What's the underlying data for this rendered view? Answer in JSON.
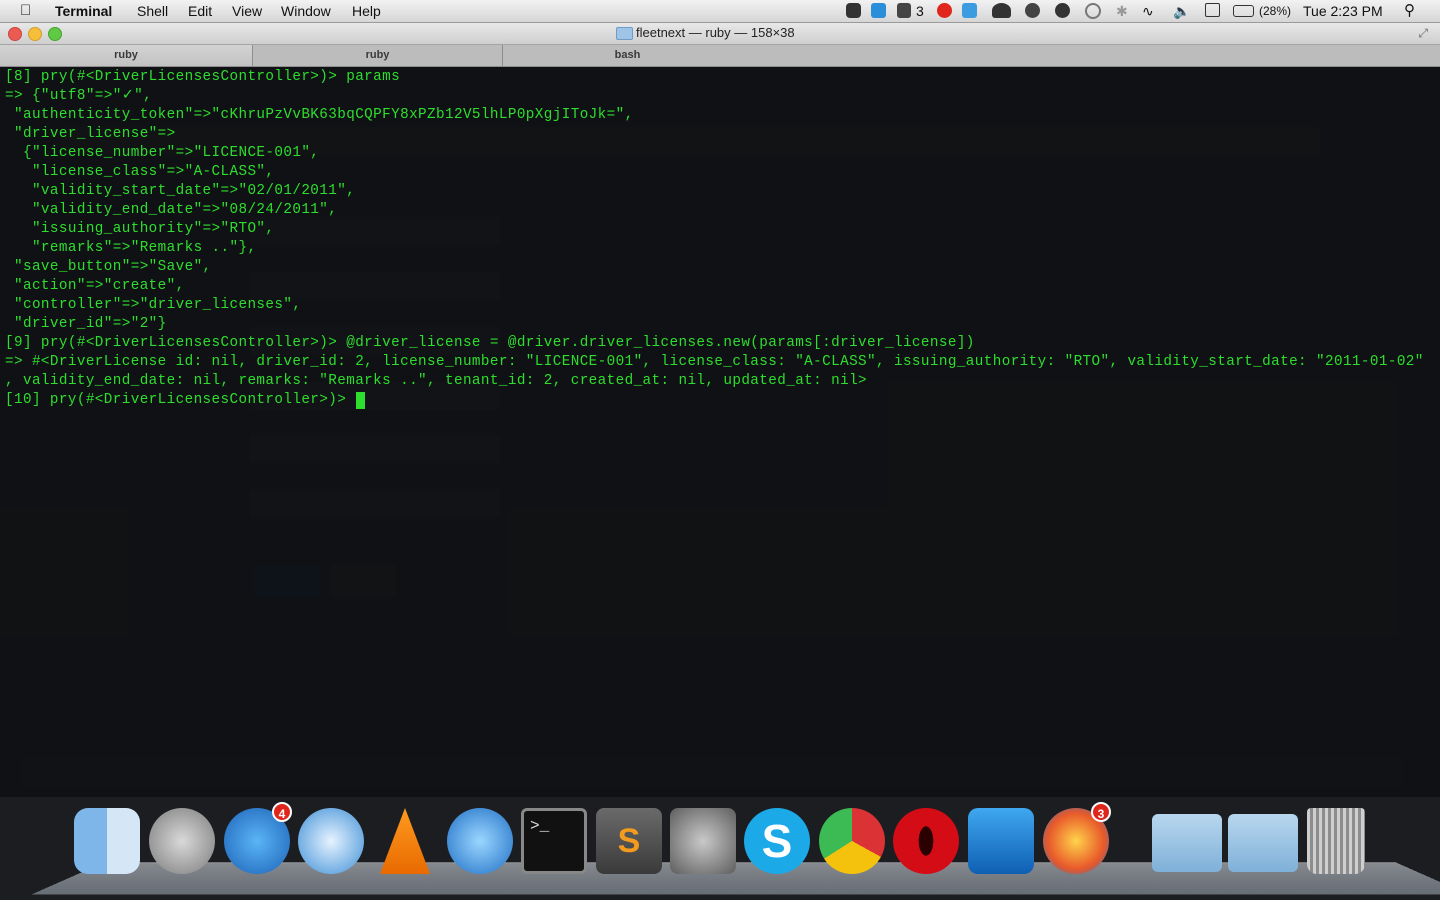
{
  "menubar": {
    "app_name": "Terminal",
    "items": [
      "Shell",
      "Edit",
      "View",
      "Window",
      "Help"
    ],
    "adobe_count": "3",
    "battery": "(28%)",
    "clock": "Tue 2:23 PM"
  },
  "window": {
    "title": "fleetnext — ruby — 158×38",
    "tabs": [
      {
        "label": "ruby",
        "active": true
      },
      {
        "label": "ruby",
        "active": false
      },
      {
        "label": "bash",
        "active": false
      }
    ]
  },
  "terminal": {
    "lines": [
      "[8] pry(#<DriverLicensesController>)> params",
      "=> {\"utf8\"=>\"✓\",",
      " \"authenticity_token\"=>\"cKhruPzVvBK63bqCQPFY8xPZb12V5lhLP0pXgjIToJk=\",",
      " \"driver_license\"=>",
      "  {\"license_number\"=>\"LICENCE-001\",",
      "   \"license_class\"=>\"A-CLASS\",",
      "   \"validity_start_date\"=>\"02/01/2011\",",
      "   \"validity_end_date\"=>\"08/24/2011\",",
      "   \"issuing_authority\"=>\"RTO\",",
      "   \"remarks\"=>\"Remarks ..\"},",
      " \"save_button\"=>\"Save\",",
      " \"action\"=>\"create\",",
      " \"controller\"=>\"driver_licenses\",",
      " \"driver_id\"=>\"2\"}",
      "[9] pry(#<DriverLicensesController>)> @driver_license = @driver.driver_licenses.new(params[:driver_license])",
      "=> #<DriverLicense id: nil, driver_id: 2, license_number: \"LICENCE-001\", license_class: \"A-CLASS\", issuing_authority: \"RTO\", validity_start_date: \"2011-01-02\"",
      ", validity_end_date: nil, remarks: \"Remarks ..\", tenant_id: 2, created_at: nil, updated_at: nil>",
      "[10] pry(#<DriverLicensesController>)> "
    ]
  },
  "dock": {
    "icons": [
      {
        "name": "finder-icon"
      },
      {
        "name": "launchpad-icon"
      },
      {
        "name": "app-store-icon",
        "badge": "4"
      },
      {
        "name": "safari-icon"
      },
      {
        "name": "vlc-icon"
      },
      {
        "name": "itunes-icon"
      },
      {
        "name": "terminal-icon"
      },
      {
        "name": "sublime-text-icon"
      },
      {
        "name": "system-preferences-icon"
      },
      {
        "name": "skype-icon"
      },
      {
        "name": "chrome-icon"
      },
      {
        "name": "opera-icon"
      },
      {
        "name": "teamviewer-icon"
      },
      {
        "name": "firefox-icon",
        "badge": "3"
      },
      {
        "name": "applications-folder-icon"
      },
      {
        "name": "downloads-folder-icon"
      },
      {
        "name": "trash-icon"
      }
    ]
  }
}
